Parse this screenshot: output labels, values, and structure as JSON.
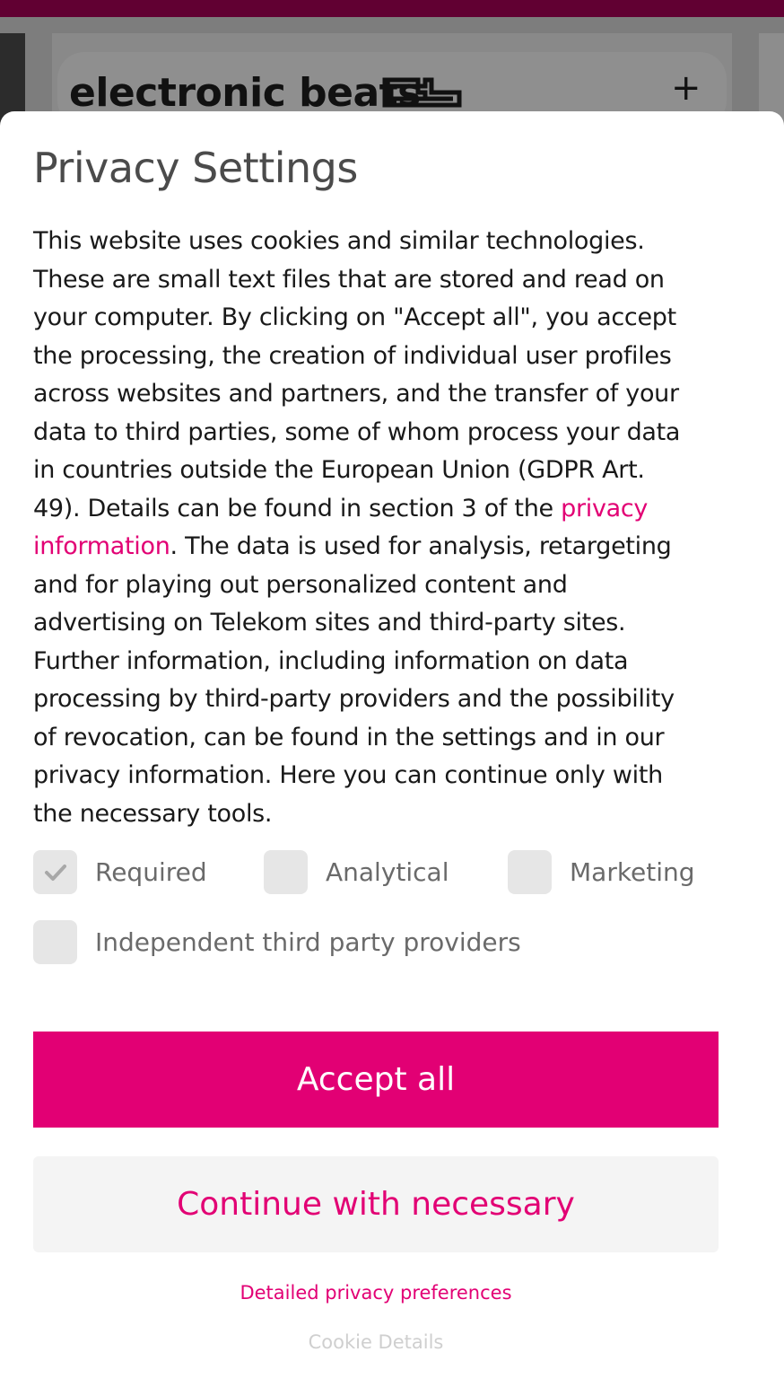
{
  "site": {
    "logo_text": "electronic beats",
    "header_action_icon": "plus-icon"
  },
  "modal": {
    "title": "Privacy Settings",
    "body_part1": "This website uses cookies and similar technologies. These are small text files that are stored and read on your computer. By clicking on \"Accept all\", you accept the processing, the creation of individual user profiles across websites and partners, and the transfer of your data to third parties, some of whom process your data in countries outside the European Union (GDPR Art. 49). Details can be found in section 3 of the ",
    "privacy_link": "privacy information",
    "body_part2": ". The data is used for analysis, retargeting and for playing out personalized content and advertising on Telekom sites and third-party sites. Further information, including information on data processing by third-party providers and the possibility of revocation, can be found in the settings and in our privacy information. Here you can continue only with the necessary tools.",
    "checkboxes": [
      {
        "label": "Required",
        "checked": true,
        "disabled": true
      },
      {
        "label": "Analytical",
        "checked": false
      },
      {
        "label": "Marketing",
        "checked": false
      },
      {
        "label": "Independent third party providers",
        "checked": false
      }
    ],
    "accept_all_label": "Accept all",
    "continue_label": "Continue with necessary",
    "detailed_link": "Detailed privacy preferences",
    "cookie_details_link": "Cookie Details"
  },
  "colors": {
    "brand_magenta": "#e20074",
    "top_bar": "#610032"
  }
}
